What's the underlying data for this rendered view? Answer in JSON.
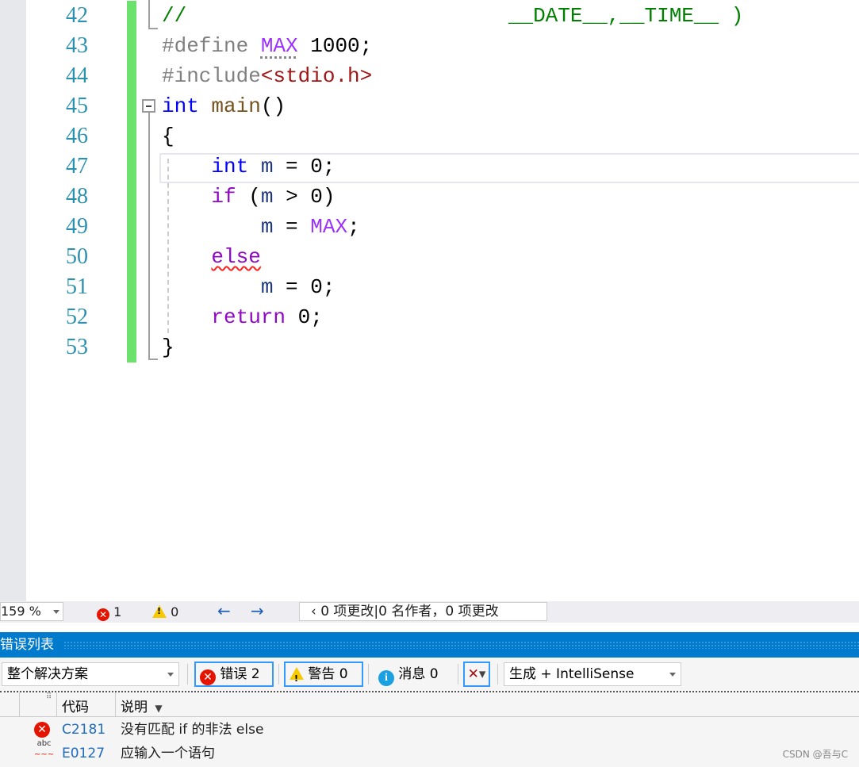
{
  "editor": {
    "lines": [
      {
        "num": "42",
        "tokens": [
          {
            "t": "//                          __DATE__,__TIME__ )",
            "c": "cmt"
          }
        ]
      },
      {
        "num": "43",
        "tokens": [
          {
            "t": "#define ",
            "c": "pp"
          },
          {
            "t": "MAX",
            "c": "mac dots"
          },
          {
            "t": " 1000;",
            "c": ""
          }
        ]
      },
      {
        "num": "44",
        "tokens": [
          {
            "t": "#include",
            "c": "pp"
          },
          {
            "t": "<stdio.h>",
            "c": "str"
          }
        ]
      },
      {
        "num": "45",
        "tokens": [
          {
            "t": "int",
            "c": "kw"
          },
          {
            "t": " ",
            "c": ""
          },
          {
            "t": "main",
            "c": "fn"
          },
          {
            "t": "()",
            "c": ""
          }
        ]
      },
      {
        "num": "46",
        "tokens": [
          {
            "t": "{",
            "c": ""
          }
        ]
      },
      {
        "num": "47",
        "tokens": [
          {
            "t": "    ",
            "c": ""
          },
          {
            "t": "int",
            "c": "kw"
          },
          {
            "t": " ",
            "c": ""
          },
          {
            "t": "m",
            "c": "id"
          },
          {
            "t": " = 0;",
            "c": ""
          }
        ]
      },
      {
        "num": "48",
        "tokens": [
          {
            "t": "    ",
            "c": ""
          },
          {
            "t": "if",
            "c": "ctl"
          },
          {
            "t": " (",
            "c": ""
          },
          {
            "t": "m",
            "c": "id"
          },
          {
            "t": " > 0)",
            "c": ""
          }
        ]
      },
      {
        "num": "49",
        "tokens": [
          {
            "t": "        ",
            "c": ""
          },
          {
            "t": "m",
            "c": "id"
          },
          {
            "t": " = ",
            "c": ""
          },
          {
            "t": "MAX",
            "c": "mac"
          },
          {
            "t": ";",
            "c": ""
          }
        ]
      },
      {
        "num": "50",
        "tokens": [
          {
            "t": "    ",
            "c": ""
          },
          {
            "t": "else",
            "c": "ctl squig"
          }
        ]
      },
      {
        "num": "51",
        "tokens": [
          {
            "t": "        ",
            "c": ""
          },
          {
            "t": "m",
            "c": "id"
          },
          {
            "t": " = 0;",
            "c": ""
          }
        ]
      },
      {
        "num": "52",
        "tokens": [
          {
            "t": "    ",
            "c": ""
          },
          {
            "t": "return",
            "c": "ctl"
          },
          {
            "t": " 0;",
            "c": ""
          }
        ]
      },
      {
        "num": "53",
        "tokens": [
          {
            "t": "}",
            "c": ""
          }
        ]
      }
    ]
  },
  "status_bar": {
    "zoom": "159 %",
    "error_count": "1",
    "warning_count": "0",
    "changes": "‹ 0 项更改|0 名作者，0 项更改"
  },
  "error_list": {
    "title": "错误列表",
    "scope": "整个解决方案",
    "errors_btn": "错误 2",
    "warnings_btn": "警告 0",
    "messages_btn": "消息 0",
    "source": "生成 + IntelliSense",
    "columns": {
      "code": "代码",
      "desc": "说明"
    },
    "rows": [
      {
        "icon": "error-icon",
        "code": "C2181",
        "desc": "没有匹配 if 的非法 else"
      },
      {
        "icon": "spelling-squiggle-icon",
        "code": "E0127",
        "desc": "应输入一个语句"
      }
    ]
  },
  "watermark": "CSDN @吾与C",
  "colors": {
    "accent": "#007acc",
    "change_bar": "#6ce26c",
    "error": "#e51400",
    "warning": "#f8c800"
  }
}
